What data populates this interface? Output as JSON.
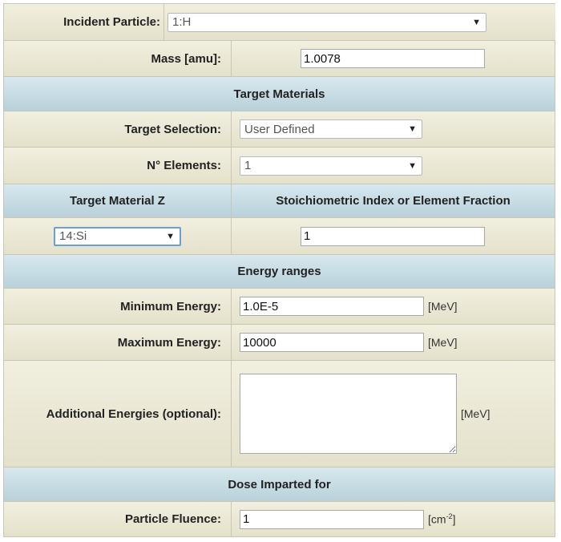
{
  "incident_particle": {
    "label": "Incident Particle:",
    "value": "1:H"
  },
  "mass": {
    "label": "Mass [amu]:",
    "value": "1.0078"
  },
  "target_materials": {
    "title": "Target Materials"
  },
  "target_selection": {
    "label": "Target Selection:",
    "value": "User Defined"
  },
  "n_elements": {
    "label": "N° Elements:",
    "value": "1"
  },
  "target_table": {
    "col_z": "Target Material Z",
    "col_index": "Stoichiometric Index or Element Fraction",
    "z_value": "14:Si",
    "index_value": "1"
  },
  "energy_ranges": {
    "title": "Energy ranges"
  },
  "min_energy": {
    "label": "Minimum Energy:",
    "value": "1.0E-5",
    "unit": "[MeV]"
  },
  "max_energy": {
    "label": "Maximum Energy:",
    "value": "10000",
    "unit": "[MeV]"
  },
  "additional_energies": {
    "label": "Additional Energies (optional):",
    "value": "",
    "unit": "[MeV]"
  },
  "dose": {
    "title": "Dose Imparted for"
  },
  "particle_fluence": {
    "label": "Particle Fluence:",
    "value": "1",
    "unit_base": "[cm",
    "unit_exp": "-2",
    "unit_close": "]"
  },
  "colors": {
    "body_bg": "#ebe8d4",
    "header_bg": "#c7dce3",
    "border": "#c9c6b1",
    "focus": "#6a9fd6"
  }
}
